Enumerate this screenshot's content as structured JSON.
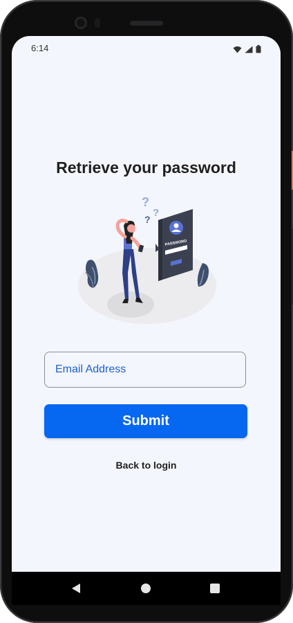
{
  "status_bar": {
    "time": "6:14",
    "icons": [
      "wifi-icon",
      "signal-icon",
      "battery-icon"
    ]
  },
  "page": {
    "title": "Retrieve your password",
    "illustration": {
      "icon": "forgot-password-illustration",
      "card_text": "PASSWORD"
    }
  },
  "form": {
    "email_placeholder": "Email Address",
    "email_value": "",
    "submit_label": "Submit",
    "back_link": "Back to login"
  },
  "nav_bar": {
    "icons": [
      "back-icon",
      "home-icon",
      "recents-icon"
    ]
  },
  "colors": {
    "primary": "#0668f0",
    "field_text": "#1a5fd1",
    "background": "#f4f6fd",
    "illustration_accent": "#5b71d6"
  }
}
